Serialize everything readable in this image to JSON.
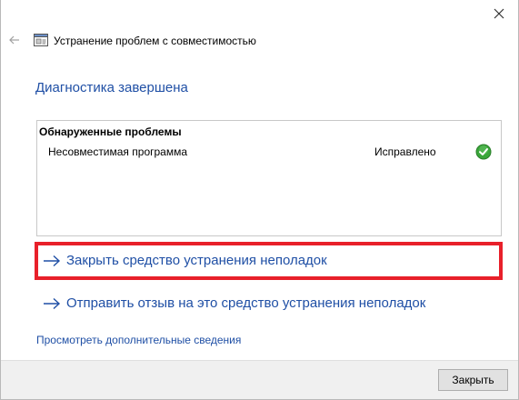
{
  "window": {
    "title": "Устранение проблем с совместимостью",
    "back_icon": "back-arrow-icon",
    "close_icon": "close-icon",
    "app_icon": "compatibility-troubleshooter-icon"
  },
  "main": {
    "heading": "Диагностика завершена",
    "issues": {
      "title": "Обнаруженные проблемы",
      "rows": [
        {
          "name": "Несовместимая программа",
          "status": "Исправлено",
          "status_icon": "green-check-icon"
        }
      ]
    },
    "actions": [
      {
        "label": "Закрыть средство устранения неполадок",
        "icon": "arrow-right-icon"
      },
      {
        "label": "Отправить отзыв на это средство устранения неполадок",
        "icon": "arrow-right-icon"
      }
    ],
    "details_link": "Просмотреть дополнительные сведения"
  },
  "footer": {
    "close_button": "Закрыть"
  },
  "colors": {
    "link": "#1f4fa5",
    "highlight": "#e8202a",
    "check_green": "#3aa63a",
    "footer_bg": "#f0f0f0"
  }
}
